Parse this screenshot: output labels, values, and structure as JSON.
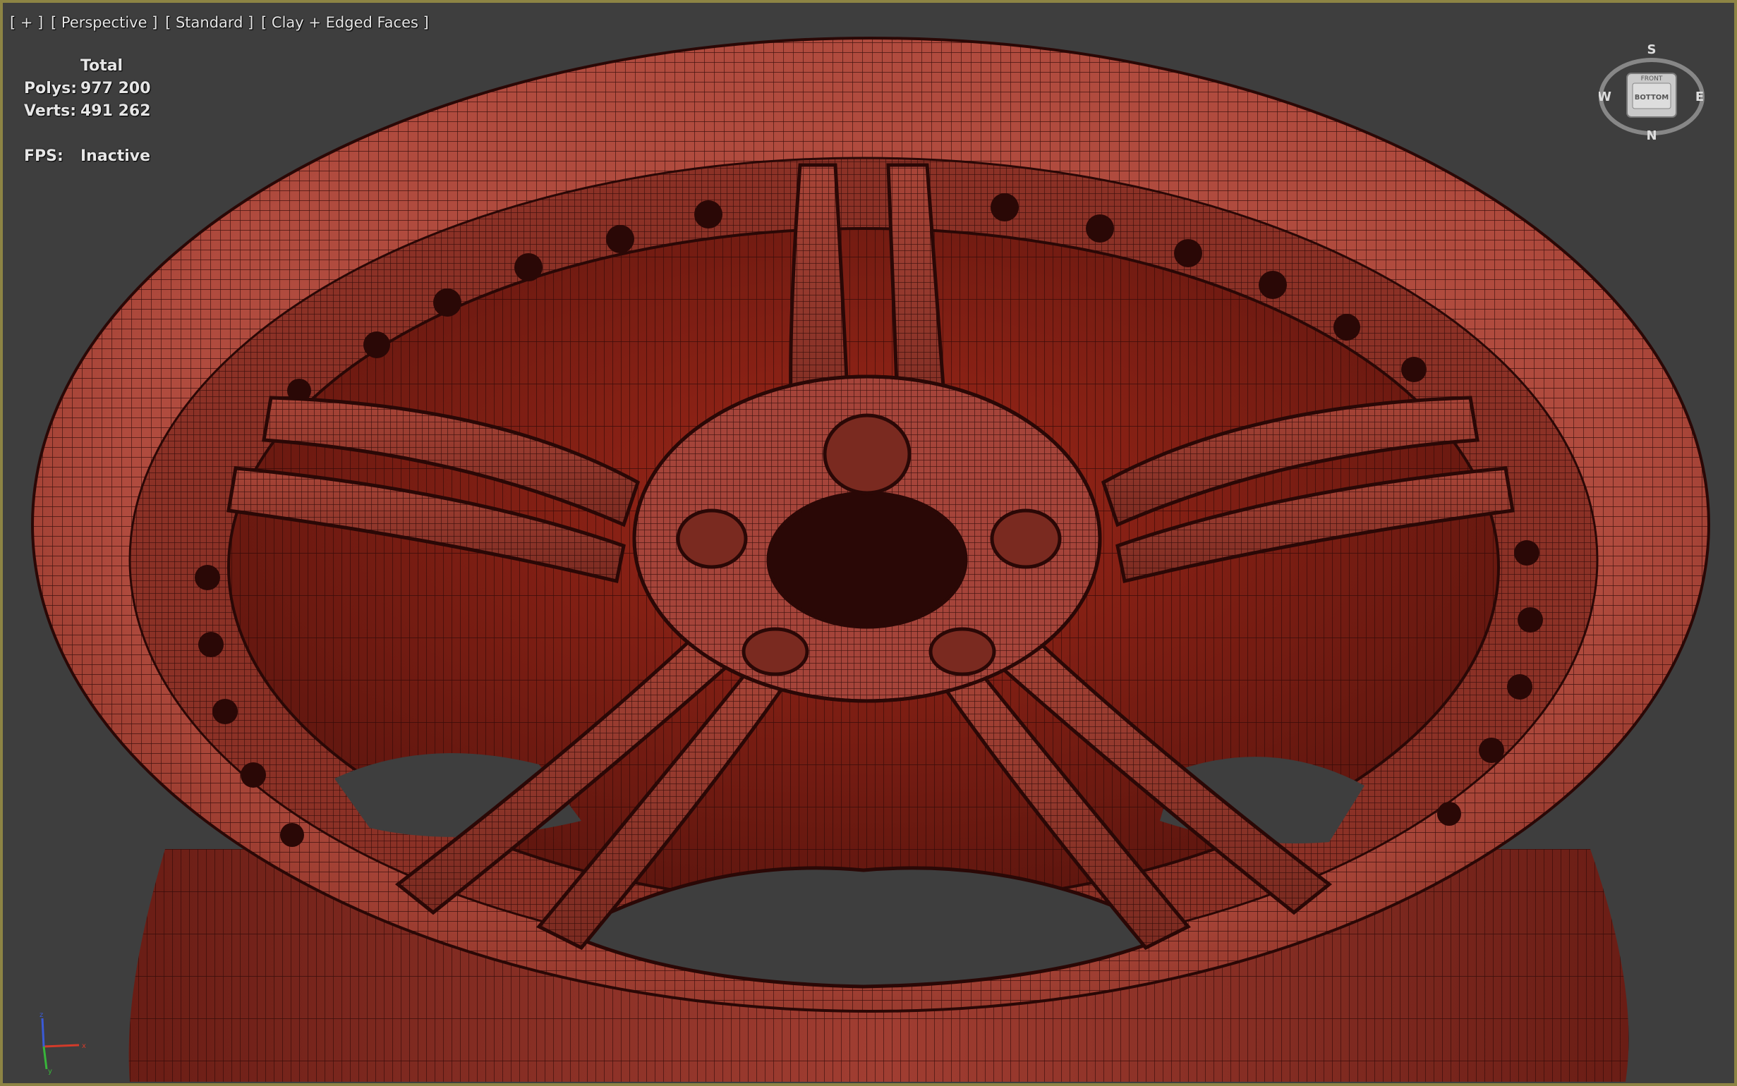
{
  "viewport": {
    "labels": [
      "[ + ]",
      "[ Perspective ]",
      "[ Standard ]",
      "[ Clay + Edged Faces ]"
    ],
    "stats": {
      "header": "Total",
      "polys_label": "Polys:",
      "polys_value": "977 200",
      "verts_label": "Verts:",
      "verts_value": "491 262",
      "fps_label": "FPS:",
      "fps_value": "Inactive"
    },
    "viewcube": {
      "north": "N",
      "south": "S",
      "east": "E",
      "west": "W",
      "face_top": "FRONT",
      "face_main": "BOTTOM"
    },
    "axis": {
      "x": "x",
      "y": "y",
      "z": "z"
    }
  },
  "colors": {
    "background": "#3e3e3e",
    "border": "#8d8444",
    "clay": "#a54438",
    "clay_dark": "#4a1310",
    "wire": "#2a0806"
  },
  "icons": [
    "viewcube-icon",
    "axis-tripod-icon"
  ]
}
